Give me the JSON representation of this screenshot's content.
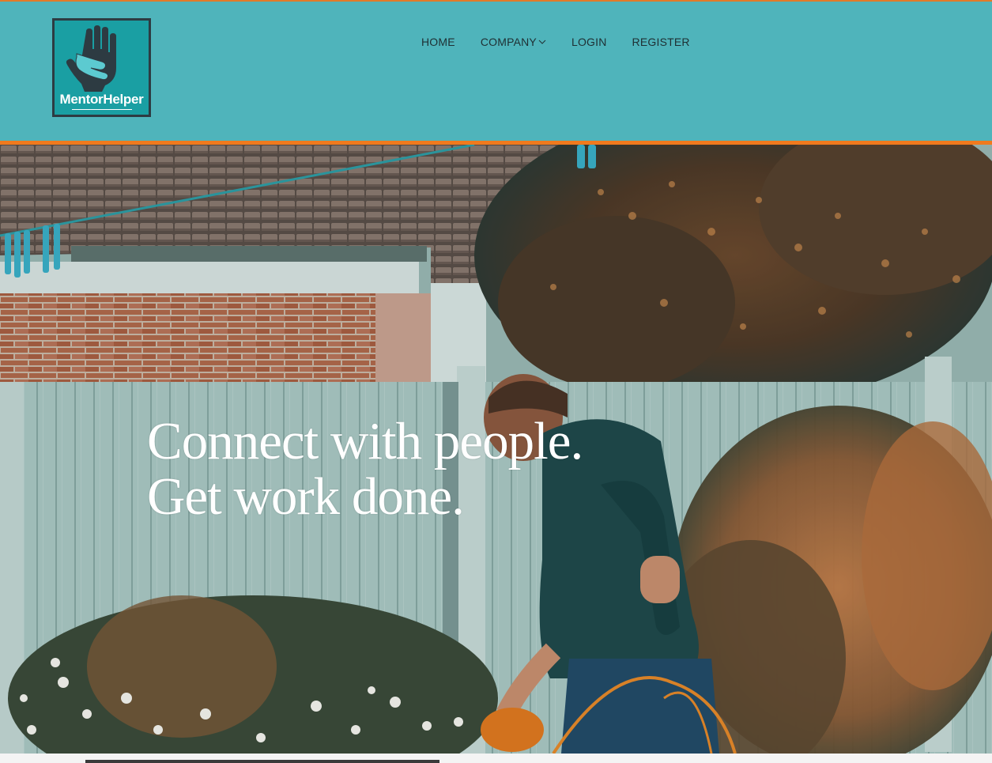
{
  "logo": {
    "name": "MentorHelper",
    "bg_color": "#1a9fa3",
    "border_color": "#2d3b42",
    "icon": "helping-hands-icon"
  },
  "header": {
    "bg_color": "#4fb4bb",
    "accent_color": "#f07a1e"
  },
  "nav": {
    "home": "HOME",
    "company": "COMPANY",
    "login": "LOGIN",
    "register": "REGISTER"
  },
  "hero": {
    "line1": "Connect with people.",
    "line2": "Get work done."
  }
}
